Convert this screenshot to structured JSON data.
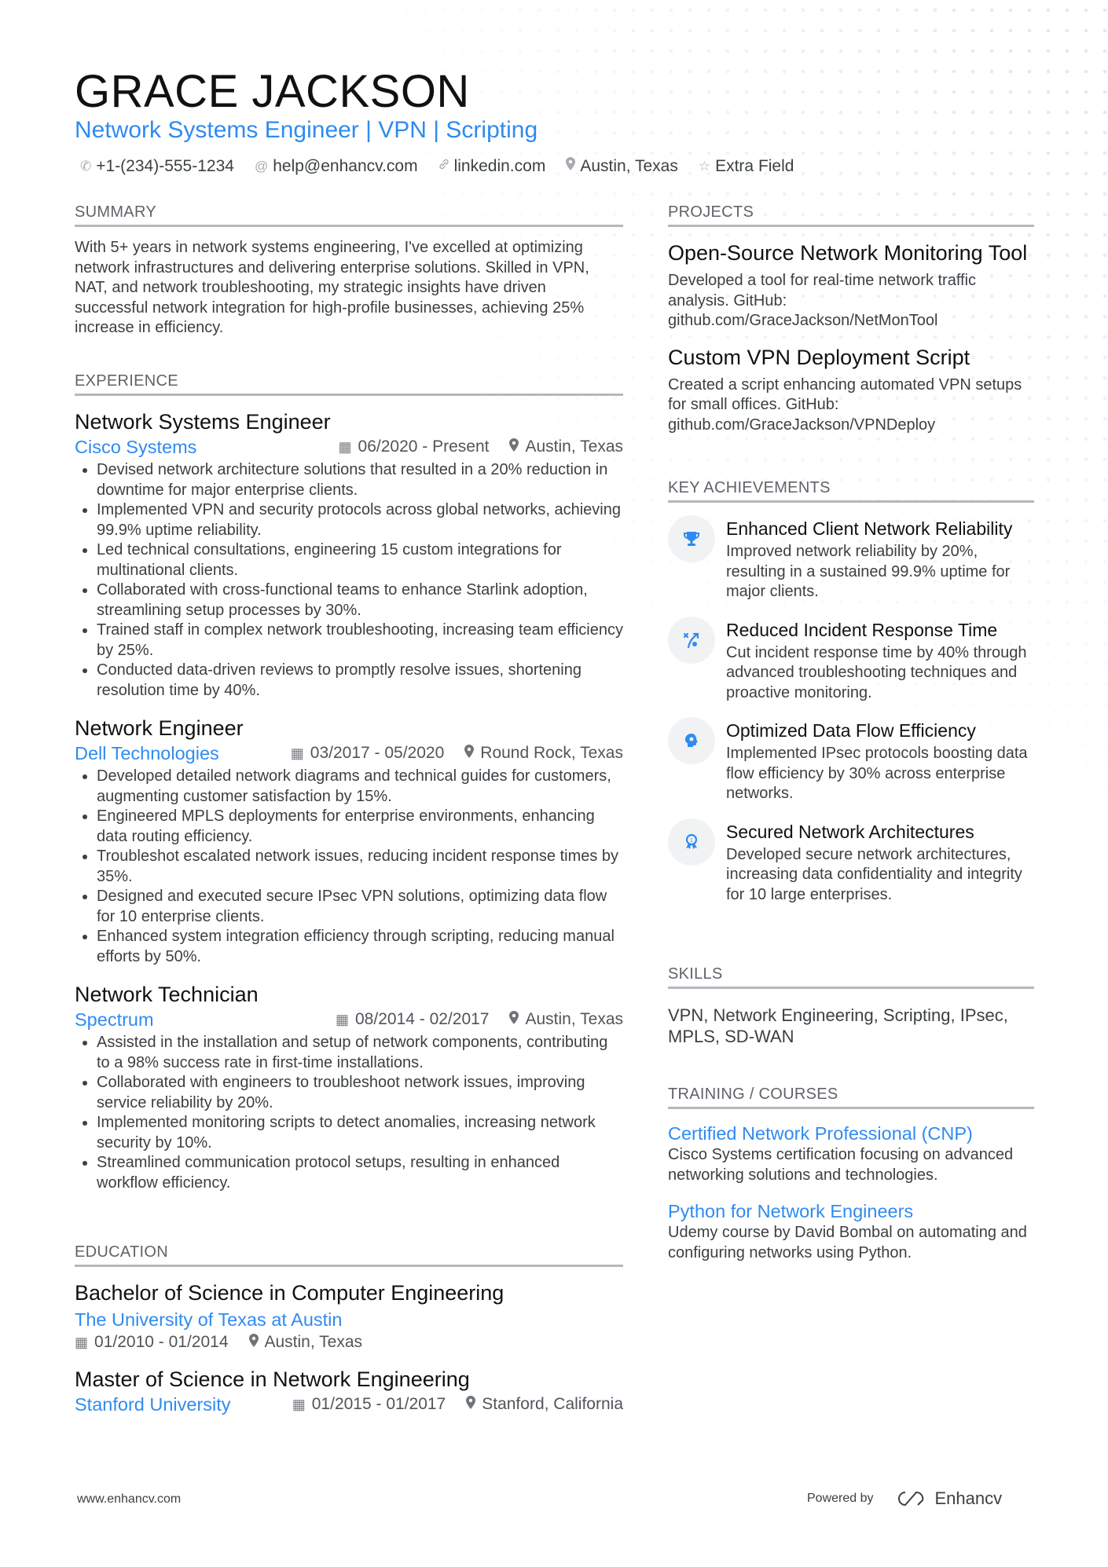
{
  "header": {
    "name": "GRACE JACKSON",
    "subtitle": "Network Systems Engineer | VPN | Scripting",
    "contact": [
      {
        "icon": "phone-icon",
        "glyph": "✆",
        "text": "+1-(234)-555-1234"
      },
      {
        "icon": "at-icon",
        "glyph": "@",
        "text": "help@enhancv.com"
      },
      {
        "icon": "link-icon",
        "glyph": "🔗︎",
        "text": "linkedin.com"
      },
      {
        "icon": "location-icon",
        "glyph": "⚲",
        "text": "Austin, Texas"
      },
      {
        "icon": "star-icon",
        "glyph": "☆",
        "text": "Extra Field"
      }
    ]
  },
  "colors": {
    "accent": "#2f8bf0",
    "text": "#3c4043",
    "heading": "#111111",
    "rule": "#b4b8bc"
  },
  "summary": {
    "heading": "SUMMARY",
    "text": "With 5+ years in network systems engineering, I've excelled at optimizing network infrastructures and delivering enterprise solutions. Skilled in VPN, NAT, and network troubleshooting, my strategic insights have driven successful network integration for high-profile businesses, achieving 25% increase in efficiency."
  },
  "experience": {
    "heading": "EXPERIENCE",
    "jobs": [
      {
        "title": "Network Systems Engineer",
        "company": "Cisco Systems",
        "dates": "06/2020 - Present",
        "location": "Austin, Texas",
        "bullets": [
          "Devised network architecture solutions that resulted in a 20% reduction in downtime for major enterprise clients.",
          "Implemented VPN and security protocols across global networks, achieving 99.9% uptime reliability.",
          "Led technical consultations, engineering 15 custom integrations for multinational clients.",
          "Collaborated with cross-functional teams to enhance Starlink adoption, streamlining setup processes by 30%.",
          "Trained staff in complex network troubleshooting, increasing team efficiency by 25%.",
          "Conducted data-driven reviews to promptly resolve issues, shortening resolution time by 40%."
        ]
      },
      {
        "title": "Network Engineer",
        "company": "Dell Technologies",
        "dates": "03/2017 - 05/2020",
        "location": "Round Rock, Texas",
        "bullets": [
          "Developed detailed network diagrams and technical guides for customers, augmenting customer satisfaction by 15%.",
          "Engineered MPLS deployments for enterprise environments, enhancing data routing efficiency.",
          "Troubleshot escalated network issues, reducing incident response times by 35%.",
          "Designed and executed secure IPsec VPN solutions, optimizing data flow for 10 enterprise clients.",
          "Enhanced system integration efficiency through scripting, reducing manual efforts by 50%."
        ]
      },
      {
        "title": "Network Technician",
        "company": "Spectrum",
        "dates": "08/2014 - 02/2017",
        "location": "Austin, Texas",
        "bullets": [
          "Assisted in the installation and setup of network components, contributing to a 98% success rate in first-time installations.",
          "Collaborated with engineers to troubleshoot network issues, improving service reliability by 20%.",
          "Implemented monitoring scripts to detect anomalies, increasing network security by 10%.",
          "Streamlined communication protocol setups, resulting in enhanced workflow efficiency."
        ]
      }
    ]
  },
  "education": {
    "heading": "EDUCATION",
    "items": [
      {
        "degree": "Bachelor of Science in Computer Engineering",
        "school": "The University of Texas at Austin",
        "dates": "01/2010 - 01/2014",
        "location": "Austin, Texas"
      },
      {
        "degree": "Master of Science in Network Engineering",
        "school": "Stanford University",
        "dates": "01/2015 - 01/2017",
        "location": "Stanford, California"
      }
    ]
  },
  "projects": {
    "heading": "PROJECTS",
    "items": [
      {
        "title": "Open-Source Network Monitoring Tool",
        "description": "Developed a tool for real-time network traffic analysis. GitHub: github.com/GraceJackson/NetMonTool"
      },
      {
        "title": "Custom VPN Deployment Script",
        "description": "Created a script enhancing automated VPN setups for small offices. GitHub: github.com/GraceJackson/VPNDeploy"
      }
    ]
  },
  "achievements": {
    "heading": "KEY ACHIEVEMENTS",
    "items": [
      {
        "icon": "trophy-icon",
        "title": "Enhanced Client Network Reliability",
        "description": "Improved network reliability by 20%, resulting in a sustained 99.9% uptime for major clients."
      },
      {
        "icon": "strategy-icon",
        "title": "Reduced Incident Response Time",
        "description": "Cut incident response time by 40% through advanced troubleshooting techniques and proactive monitoring."
      },
      {
        "icon": "brain-icon",
        "title": "Optimized Data Flow Efficiency",
        "description": "Implemented IPsec protocols boosting data flow efficiency by 30% across enterprise networks."
      },
      {
        "icon": "award-icon",
        "title": "Secured Network Architectures",
        "description": "Developed secure network architectures, increasing data confidentiality and integrity for 10 large enterprises."
      }
    ]
  },
  "skills": {
    "heading": "SKILLS",
    "text": "VPN, Network Engineering, Scripting, IPsec, MPLS, SD-WAN"
  },
  "training": {
    "heading": "TRAINING / COURSES",
    "items": [
      {
        "title": "Certified Network Professional (CNP)",
        "description": "Cisco Systems certification focusing on advanced networking solutions and technologies."
      },
      {
        "title": "Python for Network Engineers",
        "description": "Udemy course by David Bombal on automating and configuring networks using Python."
      }
    ]
  },
  "footer": {
    "website": "www.enhancv.com",
    "powered_by": "Powered by",
    "brand": "Enhancv"
  }
}
